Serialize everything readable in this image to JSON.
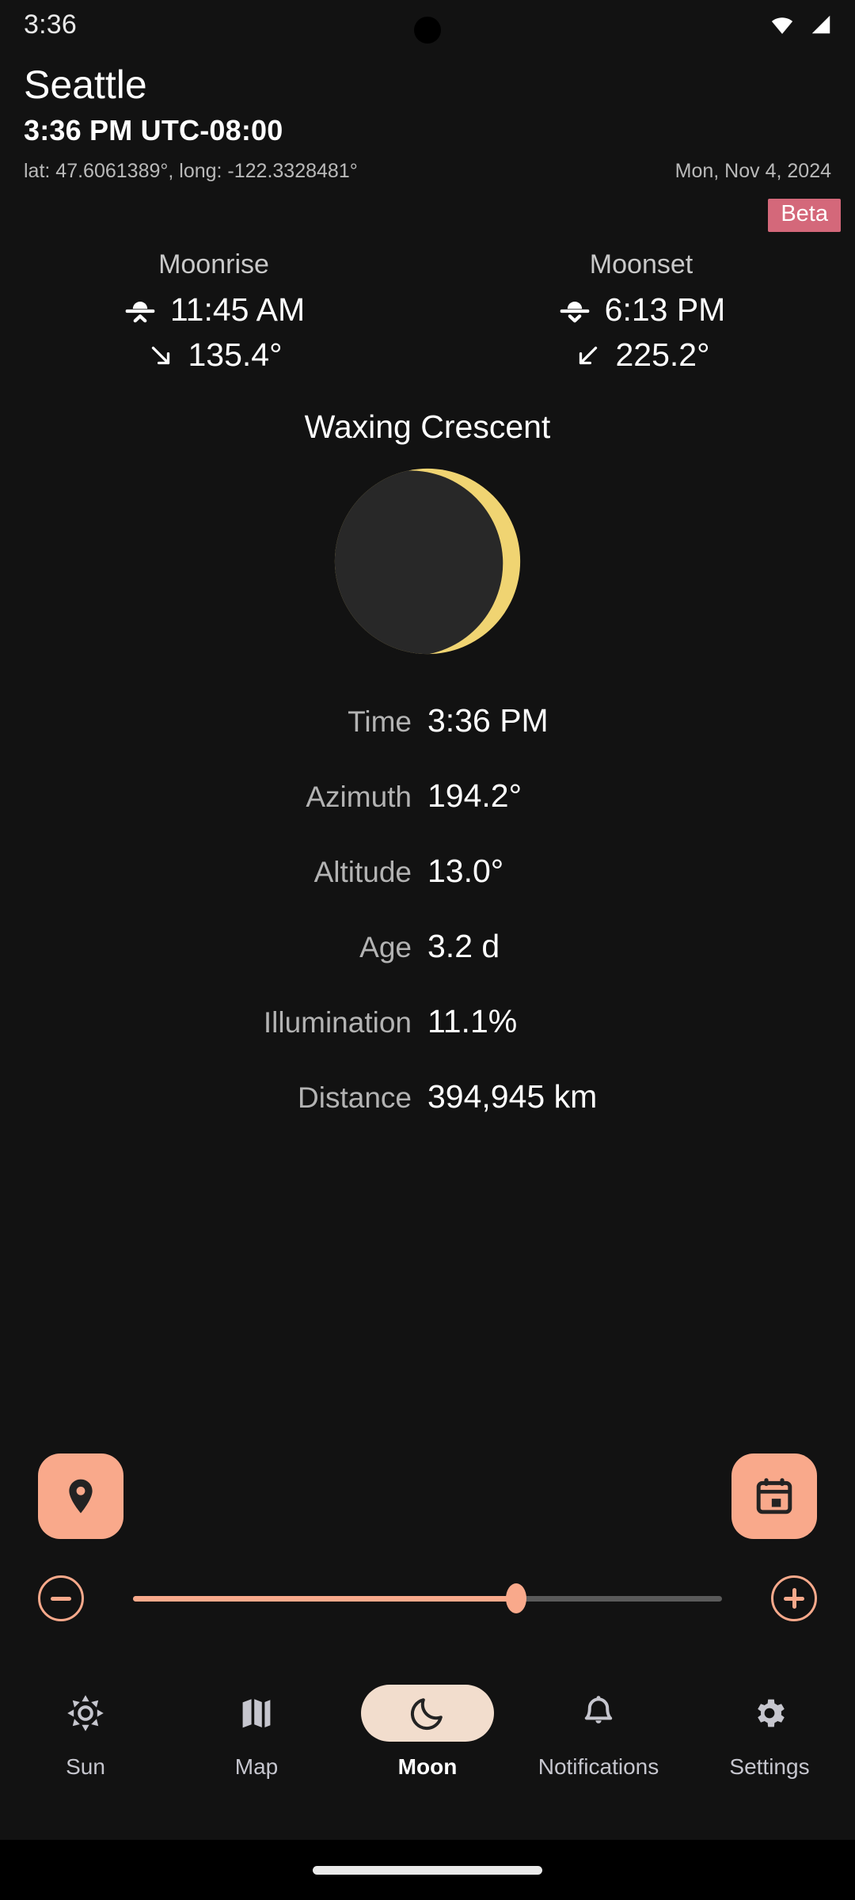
{
  "status_bar": {
    "clock": "3:36",
    "icons": [
      "wifi-icon",
      "cellular-signal-icon"
    ]
  },
  "header": {
    "city": "Seattle",
    "local_time": "3:36 PM UTC-08:00",
    "coordinates": "lat: 47.6061389°, long: -122.3328481°",
    "date": "Mon, Nov 4, 2024"
  },
  "badge": {
    "label": "Beta",
    "color": "#d4687a"
  },
  "riseset": {
    "moonrise": {
      "title": "Moonrise",
      "time": "11:45 AM",
      "azimuth": "135.4°",
      "time_icon": "moonrise-icon",
      "azimuth_icon": "arrow-down-right-icon"
    },
    "moonset": {
      "title": "Moonset",
      "time": "6:13 PM",
      "azimuth": "225.2°",
      "time_icon": "moonset-icon",
      "azimuth_icon": "arrow-down-left-icon"
    }
  },
  "phase": {
    "name": "Waxing Crescent",
    "disc_color": "#282828",
    "lit_color": "#f0d472",
    "illumination_fraction": 0.111
  },
  "details": {
    "rows": [
      {
        "label": "Time",
        "value": "3:36 PM"
      },
      {
        "label": "Azimuth",
        "value": "194.2°"
      },
      {
        "label": "Altitude",
        "value": "13.0°"
      },
      {
        "label": "Age",
        "value": "3.2 d"
      },
      {
        "label": "Illumination",
        "value": "11.1%"
      },
      {
        "label": "Distance",
        "value": "394,945 km"
      }
    ]
  },
  "actions": {
    "accent_color": "#f9a98b",
    "location_button": "location-pin-icon",
    "calendar_button": "calendar-icon"
  },
  "time_slider": {
    "decrement_label": "minus-icon",
    "increment_label": "plus-icon",
    "value_percent": 65,
    "active_color": "#f9a98b",
    "inactive_color": "#5a5a5a"
  },
  "bottom_nav": {
    "active_index": 2,
    "active_pill_color": "#f2ddcd",
    "items": [
      {
        "label": "Sun",
        "icon": "sun-icon"
      },
      {
        "label": "Map",
        "icon": "map-icon"
      },
      {
        "label": "Moon",
        "icon": "moon-crescent-icon"
      },
      {
        "label": "Notifications",
        "icon": "bell-icon"
      },
      {
        "label": "Settings",
        "icon": "gear-icon"
      }
    ]
  }
}
